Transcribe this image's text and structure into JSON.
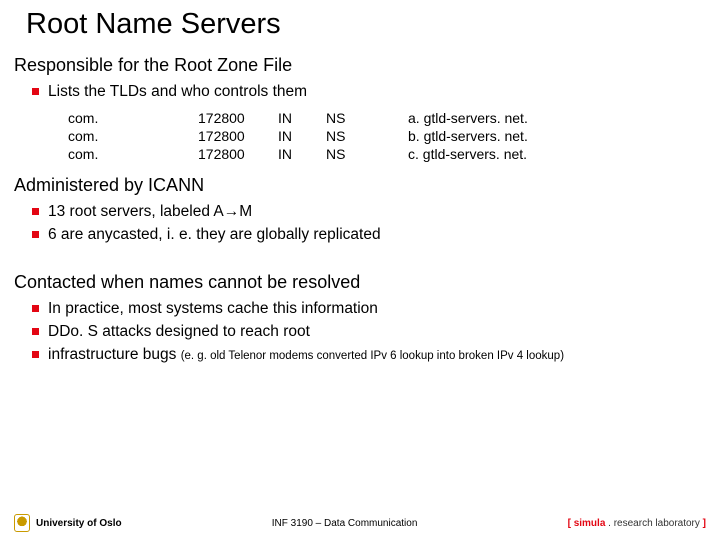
{
  "title": "Root Name Servers",
  "section1": {
    "heading": "Responsible for the Root Zone File",
    "bullet1": "Lists the TLDs and who controls them"
  },
  "zone": {
    "rows": [
      {
        "name": "com.",
        "ttl": "172800",
        "cls": "IN",
        "type": "NS",
        "target": "a. gtld-servers. net."
      },
      {
        "name": "com.",
        "ttl": "172800",
        "cls": "IN",
        "type": "NS",
        "target": "b. gtld-servers. net."
      },
      {
        "name": "com.",
        "ttl": "172800",
        "cls": "IN",
        "type": "NS",
        "target": "c. gtld-servers. net."
      }
    ]
  },
  "section2": {
    "heading": "Administered by ICANN",
    "bullet1": "13 root servers, labeled A→M",
    "bullet2": "6 are anycasted, i. e. they are globally replicated"
  },
  "section3": {
    "heading": "Contacted when names cannot be resolved",
    "bullet1": "In practice, most systems cache this information",
    "bullet2": "DDo. S attacks designed to reach root",
    "bullet3": "infrastructure bugs",
    "bullet3_note": "(e. g. old Telenor modems converted IPv 6 lookup into broken IPv 4 lookup)"
  },
  "footer": {
    "uio": "University of Oslo",
    "course": "INF 3190 – Data Communication",
    "simula_open": "[ ",
    "simula_name": "simula",
    "simula_rest": " . research laboratory",
    "simula_close": " ]"
  }
}
